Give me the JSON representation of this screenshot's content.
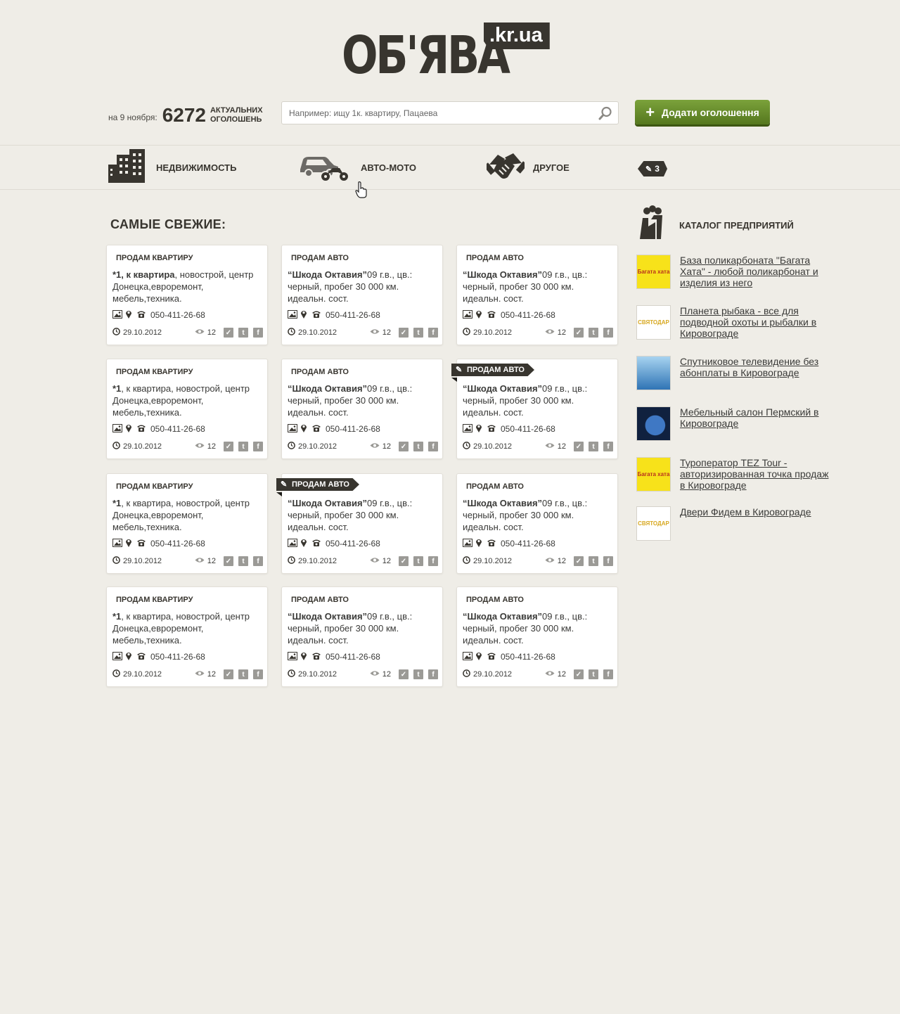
{
  "logo": {
    "main": "ОБ'ЯВА",
    "tag": ".kr.ua"
  },
  "stats": {
    "date": "на 9 ноября:",
    "count": "6272",
    "label": "АКТУАЛЬНИХ ОГОЛОШЕНЬ"
  },
  "search": {
    "placeholder": "Например: ищу 1к. квартиру, Пацаева"
  },
  "add_button": "Додати оголошення",
  "nav": {
    "items": [
      {
        "label": "НЕДВИЖИМОСТЬ",
        "icon": "buildings-icon"
      },
      {
        "label": "АВТО-МОТО",
        "icon": "car-motorcycle-icon"
      },
      {
        "label": "ДРУГОЕ",
        "icon": "handshake-icon"
      }
    ],
    "badge": "3"
  },
  "section_title": "САМЫЕ СВЕЖИЕ:",
  "cards": [
    {
      "category": "ПРОДАМ КВАРТИРУ",
      "title": "*1, к квартира",
      "desc": ", новострой, центр Донецка,евроремонт, мебель,техника.",
      "phone": "050-411-26-68",
      "date": "29.10.2012",
      "views": "12",
      "highlight": false
    },
    {
      "category": "ПРОДАМ АВТО",
      "title": "“Шкода Октавия”",
      "desc": "09 г.в., цв.: черный, пробег 30 000 км. идеальн. сост.",
      "phone": "050-411-26-68",
      "date": "29.10.2012",
      "views": "12",
      "highlight": false
    },
    {
      "category": "ПРОДАМ АВТО",
      "title": "“Шкода Октавия”",
      "desc": "09 г.в., цв.: черный, пробег 30 000 км. идеальн. сост.",
      "phone": "050-411-26-68",
      "date": "29.10.2012",
      "views": "12",
      "highlight": false
    },
    {
      "category": "ПРОДАМ КВАРТИРУ",
      "title": "*1",
      "desc": ", к квартира, новострой, центр Донецка,евроремонт, мебель,техника.",
      "phone": "050-411-26-68",
      "date": "29.10.2012",
      "views": "12",
      "highlight": false
    },
    {
      "category": "ПРОДАМ АВТО",
      "title": "“Шкода Октавия”",
      "desc": "09 г.в., цв.: черный, пробег 30 000 км. идеальн. сост.",
      "phone": "050-411-26-68",
      "date": "29.10.2012",
      "views": "12",
      "highlight": false
    },
    {
      "category": "ПРОДАМ АВТО",
      "title": "“Шкода Октавия”",
      "desc": "09 г.в., цв.: черный, пробег 30 000 км. идеальн. сост.",
      "phone": "050-411-26-68",
      "date": "29.10.2012",
      "views": "12",
      "highlight": true
    },
    {
      "category": "ПРОДАМ КВАРТИРУ",
      "title": "*1",
      "desc": ", к квартира, новострой, центр Донецка,евроремонт, мебель,техника.",
      "phone": "050-411-26-68",
      "date": "29.10.2012",
      "views": "12",
      "highlight": false
    },
    {
      "category": "ПРОДАМ АВТО",
      "title": "“Шкода Октавия”",
      "desc": "09 г.в., цв.: черный, пробег 30 000 км. идеальн. сост.",
      "phone": "050-411-26-68",
      "date": "29.10.2012",
      "views": "12",
      "highlight": true
    },
    {
      "category": "ПРОДАМ АВТО",
      "title": "“Шкода Октавия”",
      "desc": "09 г.в., цв.: черный, пробег 30 000 км. идеальн. сост.",
      "phone": "050-411-26-68",
      "date": "29.10.2012",
      "views": "12",
      "highlight": false
    },
    {
      "category": "ПРОДАМ КВАРТИРУ",
      "title": "*1",
      "desc": ", к квартира, новострой, центр Донецка,евроремонт, мебель,техника.",
      "phone": "050-411-26-68",
      "date": "29.10.2012",
      "views": "12",
      "highlight": false
    },
    {
      "category": "ПРОДАМ АВТО",
      "title": "“Шкода Октавия”",
      "desc": "09 г.в., цв.: черный, пробег 30 000 км. идеальн. сост.",
      "phone": "050-411-26-68",
      "date": "29.10.2012",
      "views": "12",
      "highlight": false
    },
    {
      "category": "ПРОДАМ АВТО",
      "title": "“Шкода Октавия”",
      "desc": "09 г.в., цв.: черный, пробег 30 000 км. идеальн. сост.",
      "phone": "050-411-26-68",
      "date": "29.10.2012",
      "views": "12",
      "highlight": false
    }
  ],
  "catalog": {
    "title": "КАТАЛОГ ПРЕДПРИЯТИЙ",
    "items": [
      {
        "text": "База поликарбоната \"Багата Хата\" - любой поликарбонат и изделия из него",
        "thumb": "yellow",
        "logo_text": "Багата хата"
      },
      {
        "text": "Планета рыбака - все для подводной охоты и рыбалки в Кировограде",
        "thumb": "white",
        "logo_text": "СВЯТОДАР"
      },
      {
        "text": "Спутниковое телевидение без абонплаты в Кировограде",
        "thumb": "sky",
        "logo_text": ""
      },
      {
        "text": "Мебельный салон Пермский в Кировограде",
        "thumb": "globe",
        "logo_text": ""
      },
      {
        "text": "Туроператор TEZ Tour - авторизированная точка продаж в Кировограде",
        "thumb": "yellow",
        "logo_text": "Багата хата"
      },
      {
        "text": "Двери Фидем в Кировограде",
        "thumb": "white",
        "logo_text": "СВЯТОДАР"
      }
    ]
  },
  "colors": {
    "background": "#efede7",
    "dark": "#38352f",
    "accent_green": "#6a8f2c"
  }
}
